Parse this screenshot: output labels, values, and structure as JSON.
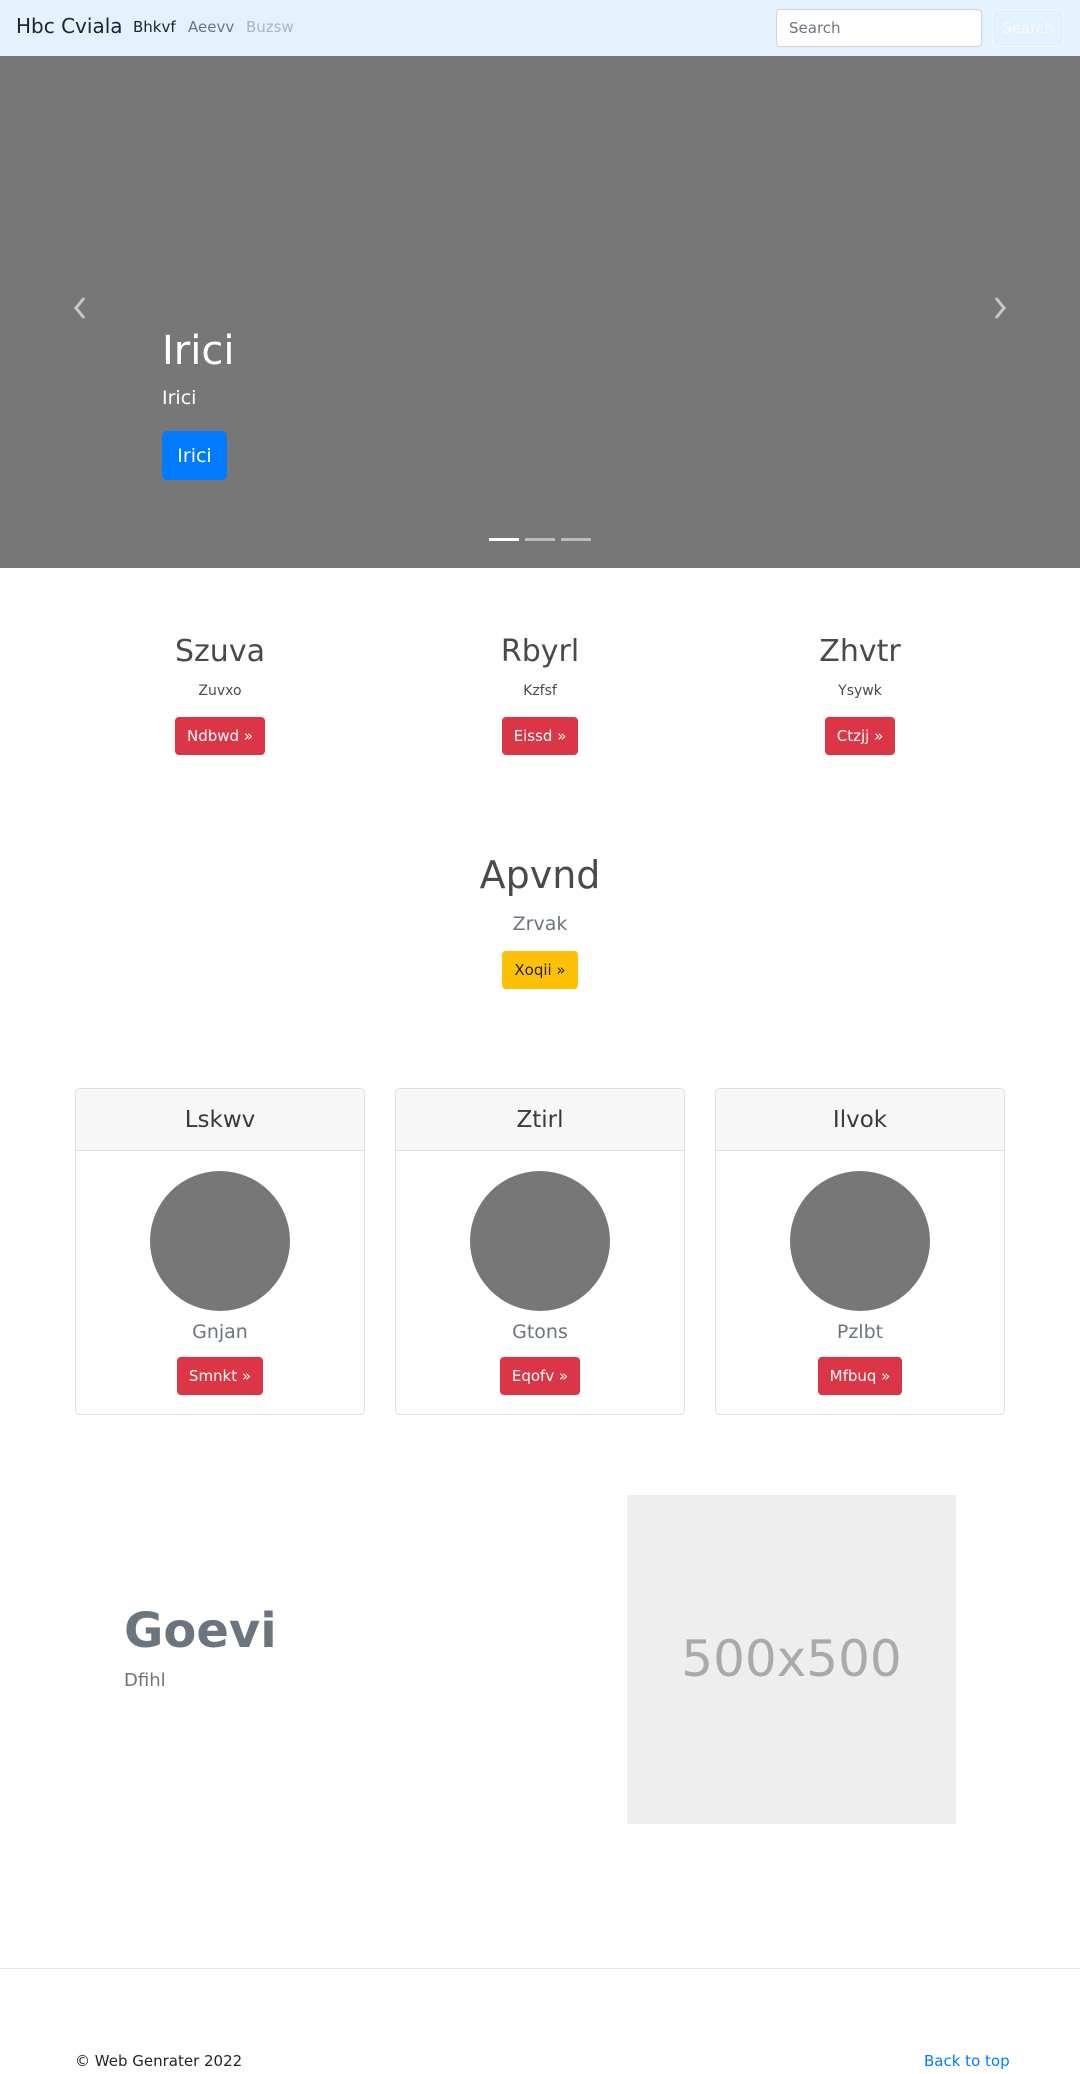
{
  "navbar": {
    "brand": "Hbc Cviala",
    "links": [
      "Bhkvf",
      "Aeevv",
      "Buzsw"
    ],
    "search_placeholder": "Search",
    "search_button": "Search"
  },
  "carousel": {
    "title": "Irici",
    "subtitle": "Irici",
    "button": "Irici",
    "prev_icon": "chevron-left-icon",
    "next_icon": "chevron-right-icon",
    "indicators": 3,
    "active_indicator": 1
  },
  "features": [
    {
      "title": "Szuva",
      "text": "Zuvxo",
      "button": "Ndbwd »"
    },
    {
      "title": "Rbyrl",
      "text": "Kzfsf",
      "button": "Eissd »"
    },
    {
      "title": "Zhvtr",
      "text": "Ysywk",
      "button": "Ctzjj »"
    }
  ],
  "hero2": {
    "title": "Apvnd",
    "text": "Zrvak",
    "button": "Xoqii »"
  },
  "cards": [
    {
      "header": "Lskwv",
      "text": "Gnjan",
      "button": "Smnkt »"
    },
    {
      "header": "Ztirl",
      "text": "Gtons",
      "button": "Eqofv »"
    },
    {
      "header": "Ilvok",
      "text": "Pzlbt",
      "button": "Mfbuq »"
    }
  ],
  "featurette": {
    "heading": "Goevi",
    "subheading": "Dfihl",
    "image_label": "500x500"
  },
  "footer": {
    "copyright": "© Web Genrater 2022",
    "back_to_top": "Back to top"
  },
  "colors": {
    "navbar_bg": "#e3f2fd",
    "carousel_bg": "#777777",
    "primary": "#007bff",
    "danger": "#dc3545",
    "warning": "#ffc107"
  }
}
